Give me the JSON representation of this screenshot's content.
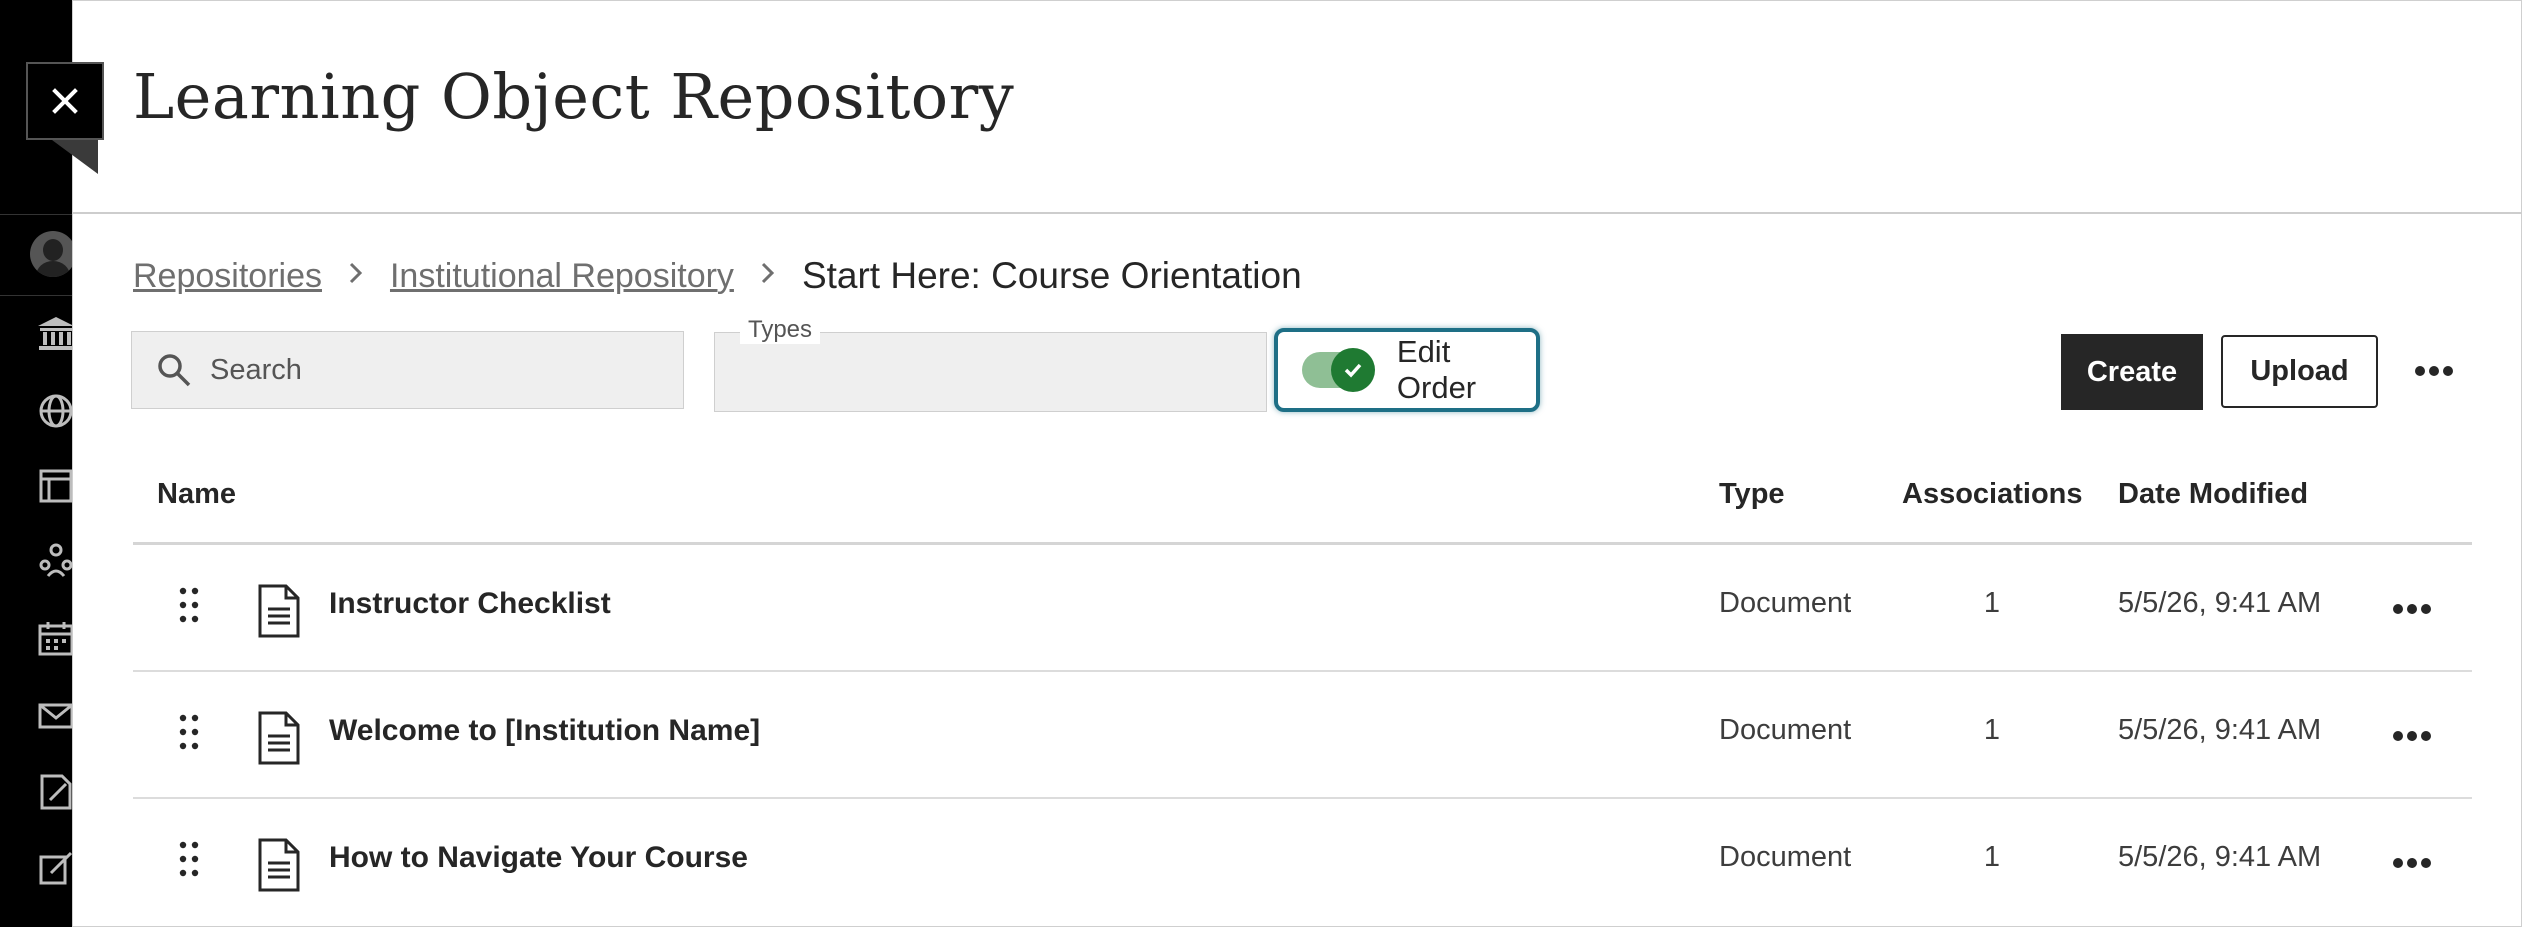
{
  "app": {
    "title": "Learning Object Repository",
    "close_label": "Close"
  },
  "rail": {
    "icons": [
      "avatar",
      "institution-icon",
      "globe-icon",
      "courses-icon",
      "groups-icon",
      "calendar-icon",
      "messages-icon",
      "grades-icon",
      "edit-icon"
    ]
  },
  "breadcrumb": {
    "items": [
      "Repositories",
      "Institutional Repository"
    ],
    "current": "Start Here: Course Orientation"
  },
  "search": {
    "placeholder": "Search"
  },
  "types": {
    "label": "Types",
    "value": ""
  },
  "edit_order": {
    "label": "Edit Order",
    "enabled": true
  },
  "toolbar": {
    "create_label": "Create",
    "upload_label": "Upload"
  },
  "table": {
    "headers": [
      "Name",
      "Type",
      "Associations",
      "Date Modified"
    ],
    "rows": [
      {
        "name": "Instructor Checklist",
        "type": "Document",
        "associations": "1",
        "date": "5/5/26, 9:41 AM"
      },
      {
        "name": "Welcome to [Institution Name]",
        "type": "Document",
        "associations": "1",
        "date": "5/5/26, 9:41 AM"
      },
      {
        "name": "How to Navigate Your Course",
        "type": "Document",
        "associations": "1",
        "date": "5/5/26, 9:41 AM"
      }
    ]
  },
  "colors": {
    "rail": "#000000",
    "toggle_on": "#1f7a32",
    "focus_ring": "#1e6f86",
    "primary_button": "#262626"
  }
}
